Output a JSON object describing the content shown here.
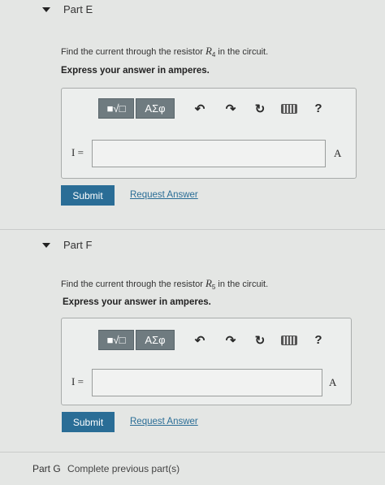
{
  "partE": {
    "title": "Part E",
    "question_prefix": "Find the current through the resistor ",
    "resistor_symbol": "R",
    "resistor_sub": "4",
    "question_suffix": " in the circuit.",
    "instruction": "Express your answer in amperes.",
    "toolbar": {
      "template_btn": "■√□",
      "greek_btn": "ΑΣφ",
      "help": "?"
    },
    "var_label": "I =",
    "input_value": "",
    "unit": "A",
    "submit_label": "Submit",
    "request_label": "Request Answer"
  },
  "partF": {
    "title": "Part F",
    "question_prefix": "Find the current through the resistor ",
    "resistor_symbol": "R",
    "resistor_sub": "5",
    "question_suffix": " in the circuit.",
    "instruction": "Express your answer in amperes.",
    "toolbar": {
      "template_btn": "■√□",
      "greek_btn": "ΑΣφ",
      "help": "?"
    },
    "var_label": "I =",
    "input_value": "",
    "unit": "A",
    "submit_label": "Submit",
    "request_label": "Request Answer"
  },
  "partG": {
    "title": "Part G",
    "status": "Complete previous part(s)"
  }
}
